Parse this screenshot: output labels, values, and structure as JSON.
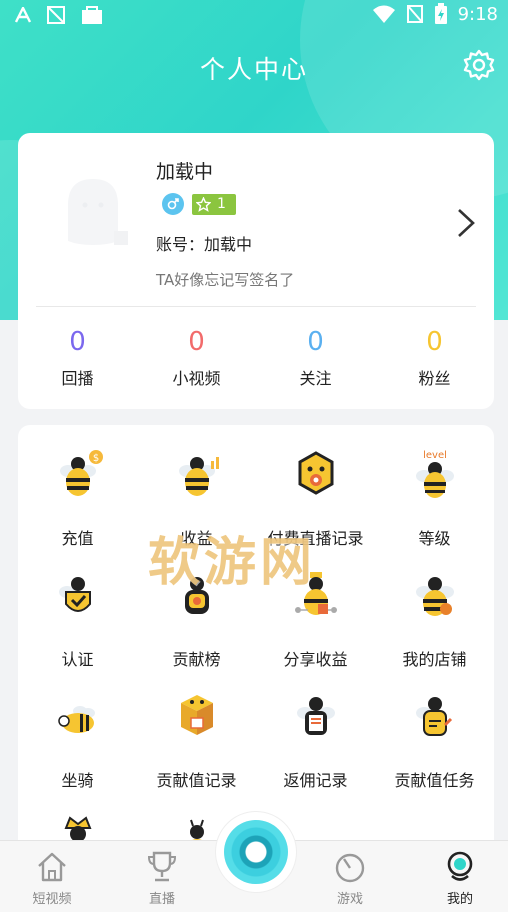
{
  "status_bar": {
    "time": "9:18"
  },
  "header": {
    "title": "个人中心"
  },
  "profile": {
    "nickname": "加载中",
    "level": "1",
    "account": "账号：加载中",
    "signature": "TA好像忘记写签名了"
  },
  "stats": [
    {
      "value": "0",
      "label": "回播",
      "color": "#7b68ee"
    },
    {
      "value": "0",
      "label": "小视频",
      "color": "#f26b6b"
    },
    {
      "value": "0",
      "label": "关注",
      "color": "#5ab0f0"
    },
    {
      "value": "0",
      "label": "粉丝",
      "color": "#f6c531"
    }
  ],
  "menu": [
    {
      "label": "充值",
      "icon": "bee-coin-icon"
    },
    {
      "label": "收益",
      "icon": "bee-chart-icon"
    },
    {
      "label": "付费直播记录",
      "icon": "bee-hexagon-icon"
    },
    {
      "label": "等级",
      "icon": "bee-level-icon"
    },
    {
      "label": "认证",
      "icon": "bee-verify-icon"
    },
    {
      "label": "贡献榜",
      "icon": "bee-rank-icon"
    },
    {
      "label": "分享收益",
      "icon": "bee-share-icon"
    },
    {
      "label": "我的店铺",
      "icon": "bee-shop-icon"
    },
    {
      "label": "坐骑",
      "icon": "bee-mount-icon"
    },
    {
      "label": "贡献值记录",
      "icon": "bee-box-icon"
    },
    {
      "label": "返佣记录",
      "icon": "bee-rebate-icon"
    },
    {
      "label": "贡献值任务",
      "icon": "bee-task-icon"
    },
    {
      "label": "",
      "icon": "bee-crown-icon"
    },
    {
      "label": "",
      "icon": "bee-extra-icon"
    }
  ],
  "watermark": "软游网",
  "tabs": [
    {
      "label": "短视频",
      "icon": "home-icon"
    },
    {
      "label": "直播",
      "icon": "trophy-icon"
    },
    {
      "label": "游戏",
      "icon": "game-icon"
    },
    {
      "label": "我的",
      "icon": "profile-icon",
      "active": true
    }
  ],
  "colors": {
    "accent": "#2fd5c9",
    "bee_yellow": "#f6c531",
    "level_green": "#8bc53f"
  }
}
